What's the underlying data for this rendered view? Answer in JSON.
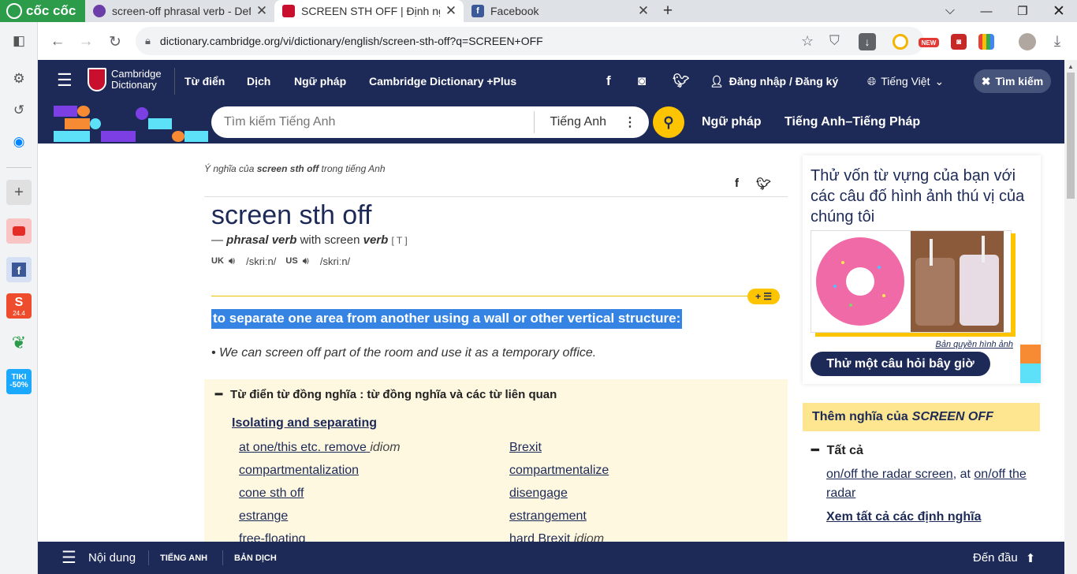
{
  "browser": {
    "brand": "cốc cốc",
    "tabs": [
      {
        "title": "screen-off phrasal verb - Defi",
        "fav_color": "#6b3ea8"
      },
      {
        "title": "SCREEN STH OFF | Định nghĩa",
        "fav_color": "#c8102e"
      },
      {
        "title": "Facebook",
        "fav_color": "#3b5998"
      }
    ],
    "new_tab_icon": "+",
    "url": "dictionary.cambridge.org/vi/dictionary/english/screen-sth-off?q=SCREEN+OFF",
    "extension_badge": "NEW"
  },
  "sidebar": {
    "tiki_label": "TIKI -50%",
    "shopee_label": "24.4"
  },
  "cambridge": {
    "logo_line1": "Cambridge",
    "logo_line2": "Dictionary",
    "nav": [
      "Từ điển",
      "Dịch",
      "Ngữ pháp",
      "Cambridge Dictionary +Plus"
    ],
    "login": "Đăng nhập / Đăng ký",
    "language": "Tiếng Việt",
    "search_toggle": "Tìm kiếm",
    "search_placeholder": "Tìm kiếm Tiếng Anh",
    "search_lang": "Tiếng Anh",
    "sublinks": [
      "Ngữ pháp",
      "Tiếng Anh–Tiếng Pháp"
    ]
  },
  "entry": {
    "crumb_prefix": "Ý nghĩa của",
    "crumb_word": "screen sth off",
    "crumb_suffix": "trong tiếng Anh",
    "headword": "screen sth off",
    "pos_dash": "—",
    "pos": "phrasal verb",
    "pos_with": "with screen",
    "pos_verb": "verb",
    "grammar": "[ T ]",
    "uk": "UK",
    "uk_ipa": "/skriːn/",
    "us": "US",
    "us_ipa": "/skriːn/",
    "definition": "to separate one area from another using a wall or other vertical structure:",
    "example": "• We can screen off part of the room and use it as a temporary office."
  },
  "thesaurus": {
    "title": "Từ điển từ đồng nghĩa : từ đồng nghĩa và các từ liên quan",
    "subtitle": "Isolating and separating",
    "left": [
      {
        "word": "at one/this etc. remove",
        "tag": "idiom"
      },
      {
        "word": "compartmentalization",
        "tag": ""
      },
      {
        "word": "cone sth off",
        "tag": ""
      },
      {
        "word": "estrange",
        "tag": ""
      },
      {
        "word": "free-floating",
        "tag": ""
      }
    ],
    "right": [
      {
        "word": "Brexit",
        "tag": ""
      },
      {
        "word": "compartmentalize",
        "tag": ""
      },
      {
        "word": "disengage",
        "tag": ""
      },
      {
        "word": "estrangement",
        "tag": ""
      },
      {
        "word": "hard Brexit",
        "tag": "idiom"
      }
    ]
  },
  "promo": {
    "text": "Thử vốn từ vựng của bạn với các câu đố hình ảnh thú vị của chúng tôi",
    "copyright": "Bản quyền hình ảnh",
    "button": "Thử một câu hỏi bây giờ"
  },
  "more": {
    "label": "Thêm nghĩa của",
    "term": "SCREEN OFF",
    "all": "Tất cả",
    "link1": "on/off the radar screen",
    "mid": ", at",
    "link2": "on/off the radar",
    "see_all": "Xem tất cả các định nghĩa"
  },
  "bottombar": {
    "contents": "Nội dung",
    "tab1": "TIẾNG ANH",
    "tab2": "BẢN DỊCH",
    "to_top": "Đến đầu"
  }
}
